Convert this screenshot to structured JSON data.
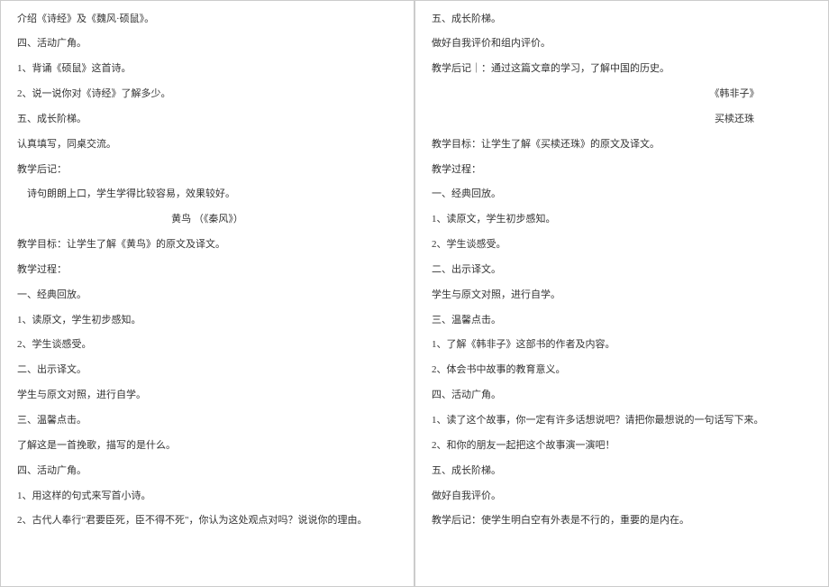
{
  "left": {
    "l0": "介绍《诗经》及《魏风·硕鼠》。",
    "l1": "四、活动广角。",
    "l2": "1、背诵《硕鼠》这首诗。",
    "l3": "2、说一说你对《诗经》了解多少。",
    "l4": "五、成长阶梯。",
    "l5": "认真填写，同桌交流。",
    "l6": "教学后记：",
    "l7": "诗句朗朗上口，学生学得比较容易，效果较好。",
    "l8": "黄鸟  （《秦风》）",
    "l9": "教学目标：让学生了解《黄鸟》的原文及译文。",
    "l10": "教学过程：",
    "l11": "一、经典回放。",
    "l12": "1、读原文，学生初步感知。",
    "l13": "2、学生谈感受。",
    "l14": "二、出示译文。",
    "l15": "学生与原文对照，进行自学。",
    "l16": "三、温馨点击。",
    "l17": "了解这是一首挽歌，描写的是什么。",
    "l18": "四、活动广角。",
    "l19": "1、用这样的句式来写首小诗。",
    "l20": "2、古代人奉行\"君要臣死，臣不得不死\"，你认为这处观点对吗？说说你的理由。"
  },
  "right": {
    "r0": "五、成长阶梯。",
    "r1": "做好自我评价和组内评价。",
    "r2": "教学后记｜：通过这篇文章的学习，了解中国的历史。",
    "r3": "《韩非子》",
    "r4": "买椟还珠",
    "r5": "教学目标：让学生了解《买椟还珠》的原文及译文。",
    "r6": "教学过程：",
    "r7": "一、经典回放。",
    "r8": "1、读原文，学生初步感知。",
    "r9": "2、学生谈感受。",
    "r10": "二、出示译文。",
    "r11": "学生与原文对照，进行自学。",
    "r12": "三、温馨点击。",
    "r13": "1、了解《韩非子》这部书的作者及内容。",
    "r14": "2、体会书中故事的教育意义。",
    "r15": "四、活动广角。",
    "r16": "1、读了这个故事，你一定有许多话想说吧？请把你最想说的一句话写下来。",
    "r17": "2、和你的朋友一起把这个故事演一演吧！",
    "r18": "五、成长阶梯。",
    "r19": "做好自我评价。",
    "r20": "教学后记：使学生明白空有外表是不行的，重要的是内在。"
  }
}
